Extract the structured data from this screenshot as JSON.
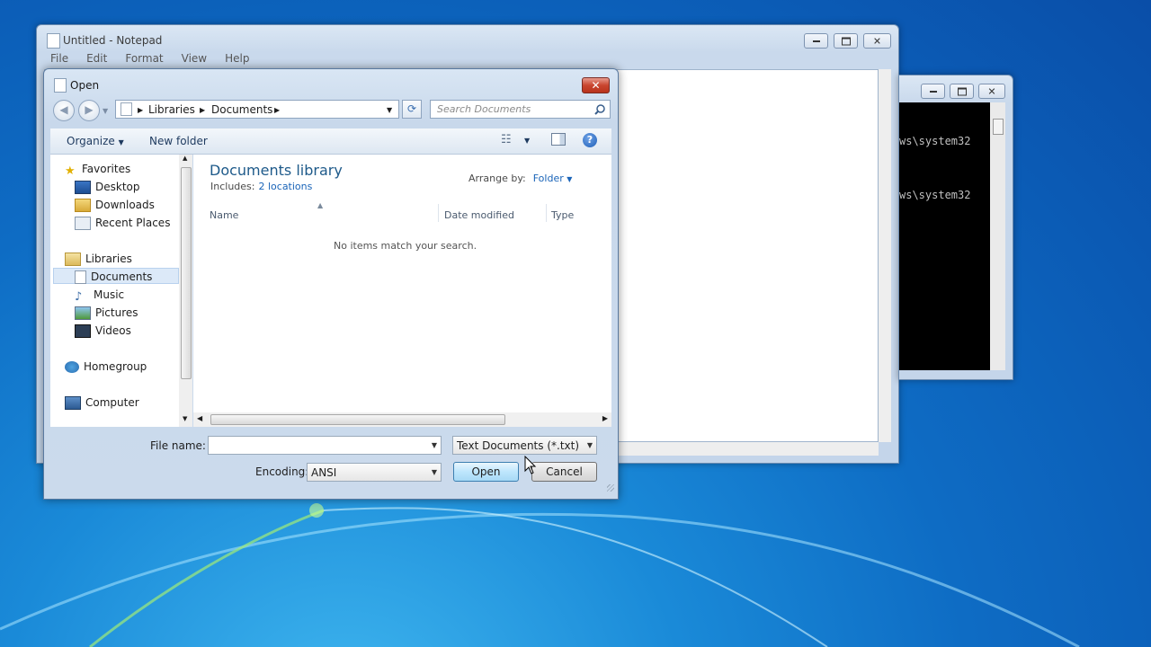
{
  "notepad": {
    "title": "Untitled - Notepad",
    "menu": [
      "File",
      "Edit",
      "Format",
      "View",
      "Help"
    ]
  },
  "console": {
    "lines": [
      "ws\\system32",
      "ws\\system32"
    ]
  },
  "dialog": {
    "title": "Open",
    "close_glyph": "✕",
    "address": {
      "root": "Libraries",
      "current": "Documents"
    },
    "search_placeholder": "Search Documents",
    "toolbar": {
      "organize": "Organize",
      "new_folder": "New folder",
      "help": "?"
    },
    "nav": {
      "favorites_header": "Favorites",
      "favorites": [
        "Desktop",
        "Downloads",
        "Recent Places"
      ],
      "libraries_header": "Libraries",
      "libraries": [
        "Documents",
        "Music",
        "Pictures",
        "Videos"
      ],
      "selected": "Documents",
      "homegroup": "Homegroup",
      "computer": "Computer"
    },
    "library": {
      "title": "Documents library",
      "includes_label": "Includes:",
      "includes_link": "2 locations",
      "arrange_label": "Arrange by:",
      "arrange_value": "Folder"
    },
    "columns": [
      "Name",
      "Date modified",
      "Type"
    ],
    "empty_message": "No items match your search.",
    "file_name_label": "File name:",
    "file_name_value": "",
    "file_type": "Text Documents (*.txt)",
    "encoding_label": "Encoding:",
    "encoding_value": "ANSI",
    "open_button": "Open",
    "cancel_button": "Cancel"
  }
}
